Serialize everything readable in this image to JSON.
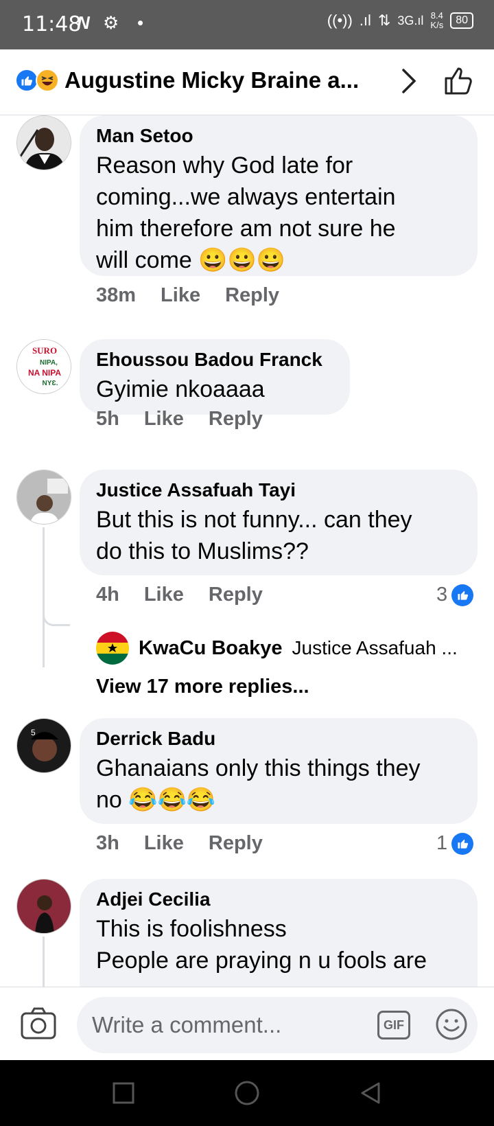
{
  "status_bar": {
    "time": "11:48",
    "speed_value": "8.4",
    "speed_unit": "K/s",
    "battery": "80",
    "network": "3G"
  },
  "header": {
    "title": "Augustine Micky Braine a...",
    "reactions": [
      "like-icon",
      "haha-icon"
    ]
  },
  "comments": [
    {
      "name": "Man Setoo",
      "text": "Reason why God late for\ncoming...we always entertain\nhim therefore am not sure he\nwill come 😀😀😀",
      "time": "38m",
      "like_label": "Like",
      "reply_label": "Reply"
    },
    {
      "name": "Ehoussou Badou Franck",
      "text": "Gyimie nkoaaaa",
      "time": "5h",
      "like_label": "Like",
      "reply_label": "Reply",
      "avatar_text": [
        "SURO",
        "NIPA,",
        "NA NIPA",
        "NYƐ."
      ]
    },
    {
      "name": "Justice Assafuah Tayi",
      "text": "But this is not funny... can they\ndo this to Muslims??",
      "time": "4h",
      "like_label": "Like",
      "reply_label": "Reply",
      "reaction_count": "3",
      "reply_preview": {
        "name": "KwaCu Boakye",
        "snippet": "Justice Assafuah ..."
      },
      "view_more": "View 17 more replies..."
    },
    {
      "name": "Derrick Badu",
      "text": "Ghanaians only this things they\nno 😂😂😂",
      "time": "3h",
      "like_label": "Like",
      "reply_label": "Reply",
      "reaction_count": "1"
    },
    {
      "name": "Adjei Cecilia",
      "text": " This is foolishness\nPeople are praying n u fools are"
    }
  ],
  "composer": {
    "placeholder": "Write a comment...",
    "gif_label": "GIF"
  },
  "colors": {
    "accent": "#1877f2",
    "bubble": "#f0f2f5",
    "muted": "#65676b",
    "status_bar": "#5b5b5b"
  }
}
